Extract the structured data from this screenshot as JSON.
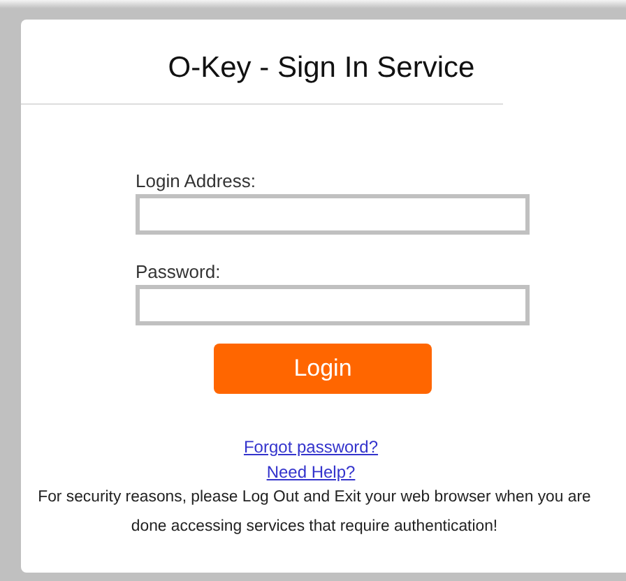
{
  "title": "O-Key - Sign In Service",
  "fields": [
    {
      "label": "Login Address:"
    },
    {
      "label": "Password:"
    }
  ],
  "button": "Login",
  "links": [
    "Forgot password?",
    "Need Help?"
  ],
  "notice": "For security reasons, please Log Out and Exit your web browser when you are done accessing services that require authentication!"
}
